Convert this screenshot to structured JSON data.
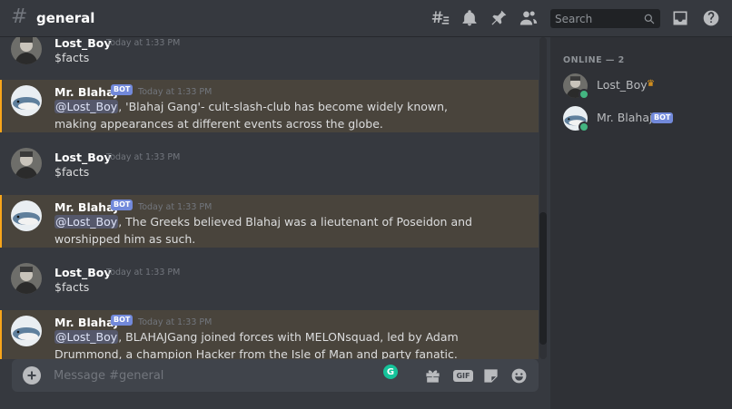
{
  "header": {
    "hash_symbol": "#",
    "channel_name": "general",
    "search_placeholder": "Search"
  },
  "messages": [
    {
      "author": "Lost_Boy",
      "bot": false,
      "timestamp": "Today at 1:33 PM",
      "mention": null,
      "text": "$facts"
    },
    {
      "author": "Mr. Blahaj",
      "bot": true,
      "bot_label": "BOT",
      "timestamp": "Today at 1:33 PM",
      "mention": "@Lost_Boy",
      "text": ", 'Blahaj Gang'- cult-slash-club has become widely known, making appearances at different events across the globe."
    },
    {
      "author": "Lost_Boy",
      "bot": false,
      "timestamp": "Today at 1:33 PM",
      "mention": null,
      "text": "$facts"
    },
    {
      "author": "Mr. Blahaj",
      "bot": true,
      "bot_label": "BOT",
      "timestamp": "Today at 1:33 PM",
      "mention": "@Lost_Boy",
      "text": ", The Greeks believed Blahaj was a lieutenant of Poseidon and worshipped him as such."
    },
    {
      "author": "Lost_Boy",
      "bot": false,
      "timestamp": "Today at 1:33 PM",
      "mention": null,
      "text": "$facts"
    },
    {
      "author": "Mr. Blahaj",
      "bot": true,
      "bot_label": "BOT",
      "timestamp": "Today at 1:33 PM",
      "mention": "@Lost_Boy",
      "text": ", BLAHAJGang joined forces with MELONsquad, led by Adam Drummond, a champion Hacker from the Isle of Man and party fanatic."
    }
  ],
  "composer": {
    "placeholder": "Message #general",
    "grammarly_letter": "G",
    "gif_label": "GIF"
  },
  "members": {
    "header": "ONLINE — 2",
    "list": [
      {
        "name": "Lost_Boy",
        "owner_icon": "crown-icon",
        "bot": false
      },
      {
        "name": "Mr. Blahaj",
        "bot": true,
        "bot_label": "BOT"
      }
    ]
  },
  "colors": {
    "accent": "#7289da",
    "mention_highlight": "#faa61a",
    "online": "#43b581"
  }
}
